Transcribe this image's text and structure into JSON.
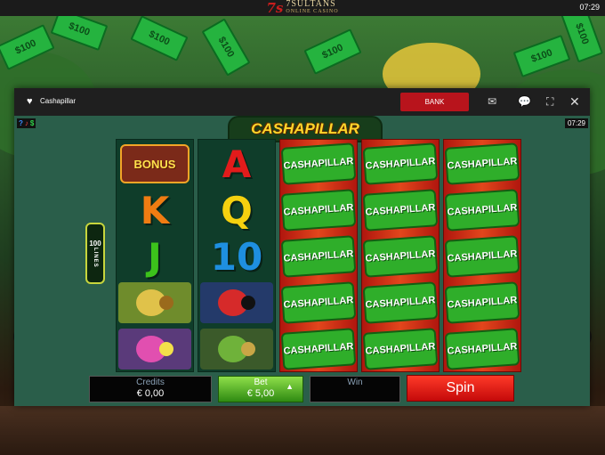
{
  "topbar": {
    "logo_mark": "7s",
    "logo_name": "7SULTANS",
    "logo_sub": "ONLINE CASINO",
    "clock": "07:29"
  },
  "background": {
    "bill_text": "$100"
  },
  "window": {
    "favorite_icon": "heart-icon",
    "game_title": "Cashapillar",
    "bank_label": "BANK",
    "icons": [
      "mail-icon",
      "chat-icon",
      "fullscreen-icon",
      "close-icon"
    ]
  },
  "game": {
    "clock": "07:29",
    "logo": "CASHAPILLAR",
    "lines_number": "100",
    "lines_label": "LINES",
    "reels": [
      {
        "style": "green",
        "symbols": [
          "BONUS",
          "K",
          "J",
          "snail",
          "caterpillar-party"
        ]
      },
      {
        "style": "green",
        "symbols": [
          "A",
          "Q",
          "10",
          "ladybugs",
          "grasshopper"
        ]
      },
      {
        "style": "red",
        "symbols": [
          "CASHAPILLAR",
          "CASHAPILLAR",
          "CASHAPILLAR",
          "CASHAPILLAR",
          "CASHAPILLAR"
        ]
      },
      {
        "style": "red",
        "symbols": [
          "CASHAPILLAR",
          "CASHAPILLAR",
          "CASHAPILLAR",
          "CASHAPILLAR",
          "CASHAPILLAR"
        ]
      },
      {
        "style": "red",
        "symbols": [
          "CASHAPILLAR",
          "CASHAPILLAR",
          "CASHAPILLAR",
          "CASHAPILLAR",
          "CASHAPILLAR"
        ]
      }
    ],
    "letter_colors": {
      "A": "#e21b1b",
      "K": "#f07c12",
      "Q": "#f5d10f",
      "J": "#3cc21b",
      "10": "#1e8fe0"
    }
  },
  "panel": {
    "credits_label": "Credits",
    "credits_value": "€ 0,00",
    "bet_label": "Bet",
    "bet_value": "€ 5,00",
    "win_label": "Win",
    "win_value": "",
    "spin_label": "Spin"
  },
  "nav": {
    "prev": "‹",
    "next": "›"
  }
}
